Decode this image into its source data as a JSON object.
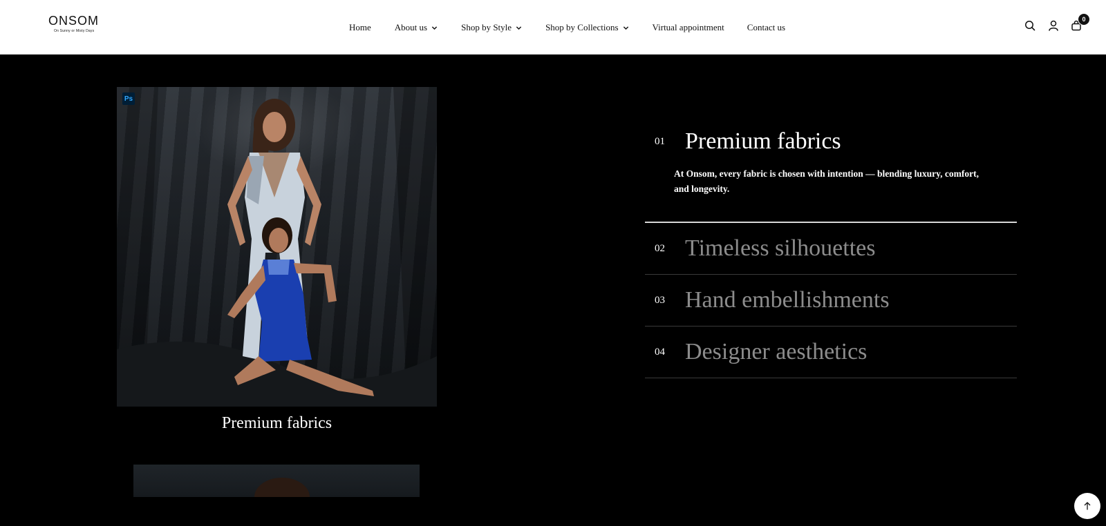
{
  "header": {
    "logo": {
      "main": "ONSOM",
      "sub": "On Sunny or Misty Days"
    },
    "nav": [
      {
        "label": "Home",
        "has_dropdown": false
      },
      {
        "label": "About us",
        "has_dropdown": true
      },
      {
        "label": "Shop by Style",
        "has_dropdown": true
      },
      {
        "label": "Shop by Collections",
        "has_dropdown": true
      },
      {
        "label": "Virtual appointment",
        "has_dropdown": false
      },
      {
        "label": "Contact us",
        "has_dropdown": false
      }
    ],
    "icons": {
      "search": "search-icon",
      "account": "user-icon",
      "cart": "bag-icon"
    },
    "cart_count": "0"
  },
  "feature": {
    "photo_badge": "Ps",
    "caption": "Premium fabrics"
  },
  "accordion": [
    {
      "num": "01",
      "title": "Premium fabrics",
      "open": true,
      "desc": "At Onsom, every fabric is chosen with intention — blending luxury, comfort, and longevity."
    },
    {
      "num": "02",
      "title": "Timeless silhouettes",
      "open": false
    },
    {
      "num": "03",
      "title": "Hand embellishments",
      "open": false
    },
    {
      "num": "04",
      "title": "Designer aesthetics",
      "open": false
    }
  ],
  "colors": {
    "background": "#000000",
    "header_bg": "#ffffff",
    "inactive_title": "#8c8c8c"
  },
  "back_to_top_icon": "arrow-up-icon"
}
